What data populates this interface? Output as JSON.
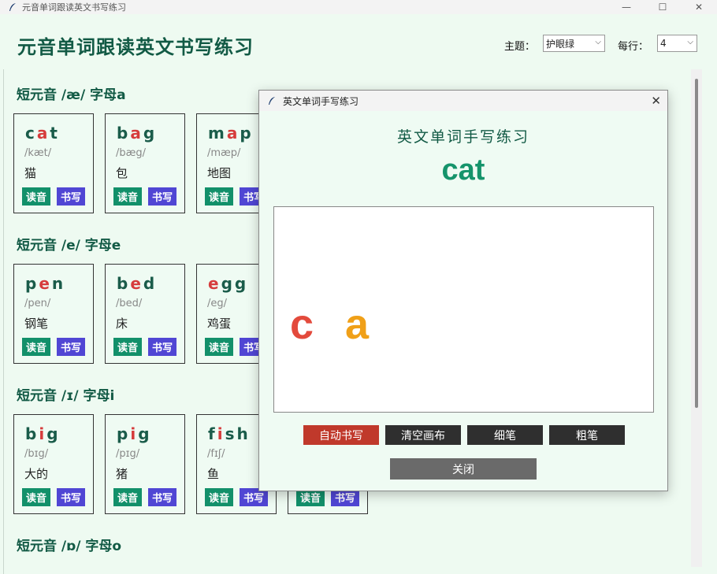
{
  "window": {
    "title": "元音单词跟读英文书写练习",
    "minimize": "—",
    "maximize": "☐",
    "close": "✕"
  },
  "header": {
    "title": "元音单词跟读英文书写练习",
    "theme_label": "主题：",
    "theme_value": "护眼绿",
    "per_row_label": "每行：",
    "per_row_value": "4"
  },
  "sections": [
    {
      "title": "短元音 /æ/ 字母a",
      "cards": [
        {
          "pre": "c",
          "vowel": "a",
          "post": "t",
          "ipa": "/kæt/",
          "cn": "猫"
        },
        {
          "pre": "b",
          "vowel": "a",
          "post": "g",
          "ipa": "/bæg/",
          "cn": "包"
        },
        {
          "pre": "m",
          "vowel": "a",
          "post": "p",
          "ipa": "/mæp/",
          "cn": "地图"
        }
      ]
    },
    {
      "title": "短元音 /e/ 字母e",
      "cards": [
        {
          "pre": "p",
          "vowel": "e",
          "post": "n",
          "ipa": "/pen/",
          "cn": "钢笔"
        },
        {
          "pre": "b",
          "vowel": "e",
          "post": "d",
          "ipa": "/bed/",
          "cn": "床"
        },
        {
          "pre": "",
          "vowel": "e",
          "post": "gg",
          "ipa": "/eg/",
          "cn": "鸡蛋"
        }
      ]
    },
    {
      "title": "短元音 /ɪ/ 字母i",
      "cards": [
        {
          "pre": "b",
          "vowel": "i",
          "post": "g",
          "ipa": "/bɪg/",
          "cn": "大的"
        },
        {
          "pre": "p",
          "vowel": "i",
          "post": "g",
          "ipa": "/pɪg/",
          "cn": "猪"
        },
        {
          "pre": "f",
          "vowel": "i",
          "post": "sh",
          "ipa": "/fɪʃ/",
          "cn": "鱼"
        },
        {
          "pre": "",
          "vowel": "",
          "post": "",
          "ipa": "",
          "cn": ""
        }
      ]
    },
    {
      "title": "短元音 /ɒ/ 字母o",
      "cards": []
    }
  ],
  "card_buttons": {
    "read": "读音",
    "write": "书写"
  },
  "dialog": {
    "title": "英文单词手写练习",
    "heading": "英文单词手写练习",
    "word": "cat",
    "canvas_letters": [
      {
        "char": "c",
        "color": "#e34a3c"
      },
      {
        "char": "a",
        "color": "#f0a018"
      }
    ],
    "buttons": {
      "auto": "自动书写",
      "clear": "清空画布",
      "thin": "细笔",
      "thick": "粗笔"
    },
    "close_label": "关闭"
  },
  "colors": {
    "accent": "#12906a",
    "write_button": "#5046d4",
    "vowel": "#d63c3c",
    "auto_button": "#c0392b"
  }
}
